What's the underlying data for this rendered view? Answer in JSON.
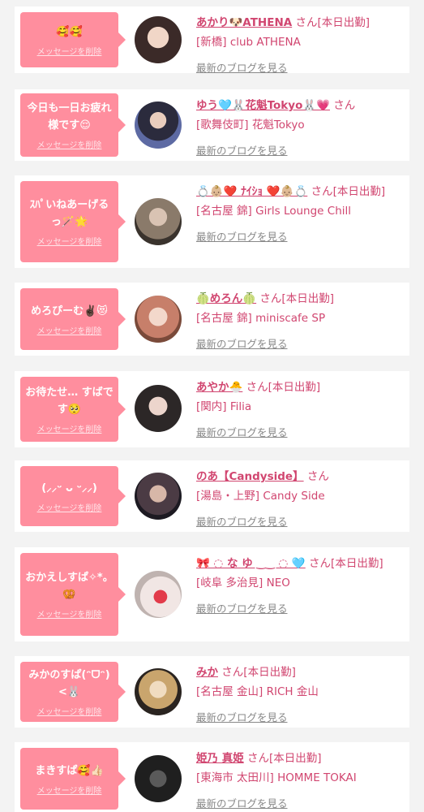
{
  "ui": {
    "delete_label": "メッセージを削除",
    "blog_label": "最新のブログを見る",
    "san": "さん"
  },
  "colors": {
    "bubble": "#ff8e9e",
    "name": "#d14670",
    "link_gray": "#888888",
    "page_bg": "#f3f3f3"
  },
  "cards": [
    {
      "message": "🥰🥰",
      "name": "あかり🐶ATHENA",
      "status": "[本日出勤]",
      "shop": "[新橋] club ATHENA"
    },
    {
      "message": "今日も一日お疲れ様です😌",
      "name": "ゆう🩵🐰花魁Tokyo🐰💗",
      "status": "",
      "shop": "[歌舞伎町] 花魁Tokyo"
    },
    {
      "message": "ｽﾊﾟいねあーげるっ🪄🌟",
      "name": "💍👶🏼❤️ ﾅｲｼｮ ❤️👶🏼💍",
      "status": "[本日出勤]",
      "shop": "[名古屋 錦] Girls Lounge Chill"
    },
    {
      "message": "めろぴーむ✌🏿😻",
      "name": "🍈めろん🍈",
      "status": "[本日出勤]",
      "shop": "[名古屋 錦] miniscafe SP"
    },
    {
      "message": "お待たせ… すばです🥺",
      "name": "あやか🐣",
      "status": "[本日出勤]",
      "shop": "[関内] Filia"
    },
    {
      "message": "(⸝⸝ᵕ ᴗ ᵕ⸝⸝)",
      "name": "のあ【Candyside】",
      "status": "",
      "shop": "[湯島・上野] Candy Side"
    },
    {
      "message": "おかえしすぱ✧*。🥨",
      "name": "🎀 ◌ な ゆ ‿‿ ◌ 🩵",
      "status": "[本日出勤]",
      "shop": "[岐阜 多治見] NEO"
    },
    {
      "message": "みかのすぱ(ᵔᗜᵔ)<🐰",
      "name": "みか",
      "status": "[本日出勤]",
      "shop": "[名古屋 金山] RICH 金山"
    },
    {
      "message": "まきすぱ🥰👍🏻",
      "name": "姫乃 真姫",
      "status": "[本日出勤]",
      "shop": "[東海市 太田川] HOMME TOKAI"
    }
  ]
}
